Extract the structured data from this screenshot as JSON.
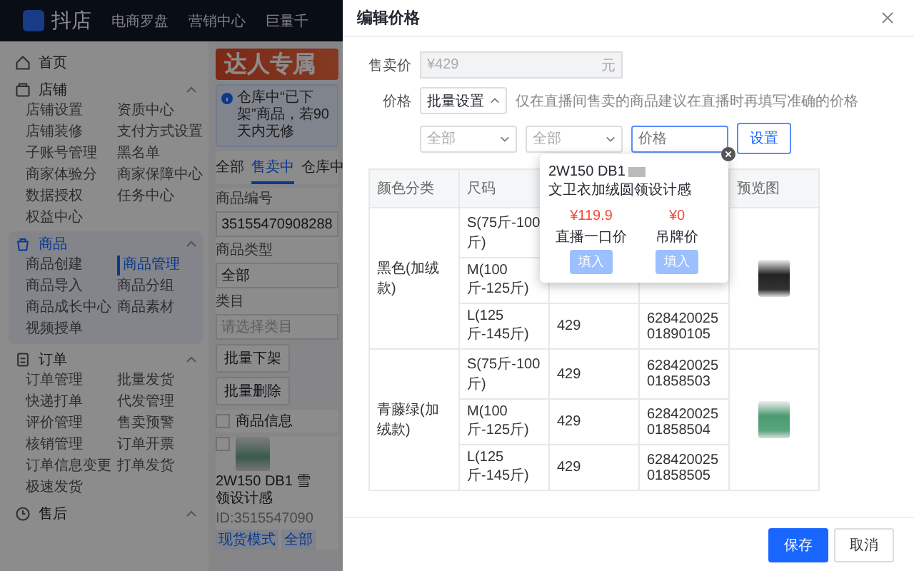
{
  "topbar": {
    "logo": "抖店",
    "nav": [
      "电商罗盘",
      "营销中心",
      "巨量千"
    ]
  },
  "sidebar": [
    {
      "kind": "link",
      "label": "首页",
      "selected": false
    },
    {
      "kind": "group",
      "label": "店铺",
      "expanded": true,
      "selected": false,
      "items": [
        {
          "label": "店铺设置",
          "selected": false
        },
        {
          "label": "资质中心",
          "selected": false
        },
        {
          "label": "店铺装修",
          "selected": false
        },
        {
          "label": "支付方式设置",
          "selected": false
        },
        {
          "label": "子账号管理",
          "selected": false
        },
        {
          "label": "黑名单",
          "selected": false
        },
        {
          "label": "商家体验分",
          "selected": false
        },
        {
          "label": "商家保障中心",
          "selected": false
        },
        {
          "label": "数据授权",
          "selected": false
        },
        {
          "label": "任务中心",
          "selected": false
        },
        {
          "label": "权益中心",
          "selected": false
        }
      ]
    },
    {
      "kind": "group",
      "label": "商品",
      "expanded": true,
      "selected": true,
      "items": [
        {
          "label": "商品创建",
          "selected": false
        },
        {
          "label": "商品管理",
          "selected": true
        },
        {
          "label": "商品导入",
          "selected": false
        },
        {
          "label": "商品分组",
          "selected": false
        },
        {
          "label": "商品成长中心",
          "selected": false
        },
        {
          "label": "商品素材",
          "selected": false
        },
        {
          "label": "视频授单",
          "selected": false
        }
      ]
    },
    {
      "kind": "group",
      "label": "订单",
      "expanded": true,
      "selected": false,
      "items": [
        {
          "label": "订单管理",
          "selected": false
        },
        {
          "label": "批量发货",
          "selected": false
        },
        {
          "label": "快递打单",
          "selected": false
        },
        {
          "label": "代发管理",
          "selected": false
        },
        {
          "label": "评价管理",
          "selected": false
        },
        {
          "label": "售卖预警",
          "selected": false
        },
        {
          "label": "核销管理",
          "selected": false
        },
        {
          "label": "订单开票",
          "selected": false
        },
        {
          "label": "订单信息变更",
          "selected": false
        },
        {
          "label": "打单发货",
          "selected": false
        },
        {
          "label": "极速发货",
          "selected": false
        }
      ]
    },
    {
      "kind": "group",
      "label": "售后",
      "expanded": true,
      "selected": false
    }
  ],
  "banner": {
    "text": "达人专属"
  },
  "notice": {
    "text": "仓库中“已下架”商品，若90天内无修"
  },
  "status_tabs": [
    {
      "label": "全部",
      "selected": false
    },
    {
      "label": "售卖中",
      "selected": true
    },
    {
      "label": "仓库中",
      "selected": false
    }
  ],
  "filters": [
    {
      "label": "商品编号",
      "value": "35155470908288"
    },
    {
      "label": "商品类型",
      "value": "全部"
    },
    {
      "label": "类目",
      "placeholder": "请选择类目"
    }
  ],
  "bulk_actions": [
    "批量下架",
    "批量删除"
  ],
  "product_table": {
    "header": "商品信息",
    "checked": false,
    "rows": [
      {
        "checked": false,
        "title_lines": [
          "2W150 DB1 雪",
          "领设计感"
        ],
        "id": "ID:3515547090",
        "tags": [
          "现货模式",
          "全部"
        ]
      }
    ]
  },
  "dialog": {
    "title": "编辑价格",
    "sale_price": {
      "label": "售卖价",
      "value": "¥429",
      "unit": "元",
      "disabled": true
    },
    "price": {
      "label": "价格",
      "mode": "批量设置",
      "mode_open": true,
      "hint": "仅在直播间售卖的商品建议在直播时再填写准确的价格"
    },
    "batch": {
      "selects": [
        "全部",
        "全部"
      ],
      "price_placeholder": "价格",
      "apply": "设置"
    },
    "sku_table": {
      "columns": [
        "颜色分类",
        "尺码",
        null,
        null,
        "预览图"
      ],
      "groups": [
        {
          "variant": "黑色(加绒款)",
          "skus": [
            {
              "size": "S(75斤-100斤)"
            },
            {
              "size": "M(100斤-125斤)"
            },
            {
              "size": "L(125斤-145斤)",
              "price": "429",
              "code": "62842002501890105"
            }
          ]
        },
        {
          "variant": "青藤绿(加绒款)",
          "skus": [
            {
              "size": "S(75斤-100斤)",
              "price": "429",
              "code": "62842002501858503"
            },
            {
              "size": "M(100斤-125斤)",
              "price": "429",
              "code": "62842002501858504"
            },
            {
              "size": "L(125斤-145斤)",
              "price": "429",
              "code": "62842002501858505"
            }
          ]
        }
      ]
    },
    "popover": {
      "title_start": "2W150 DB1",
      "title_end": "文卫衣加绒圆领设计感",
      "prices": [
        {
          "amount": "¥119.9",
          "label": "直播一口价",
          "action": "填入"
        },
        {
          "amount": "¥0",
          "label": "吊牌价",
          "action": "填入"
        }
      ]
    },
    "buttons": [
      {
        "label": "保存",
        "kind": "primary"
      },
      {
        "label": "取消",
        "kind": "default"
      }
    ]
  }
}
